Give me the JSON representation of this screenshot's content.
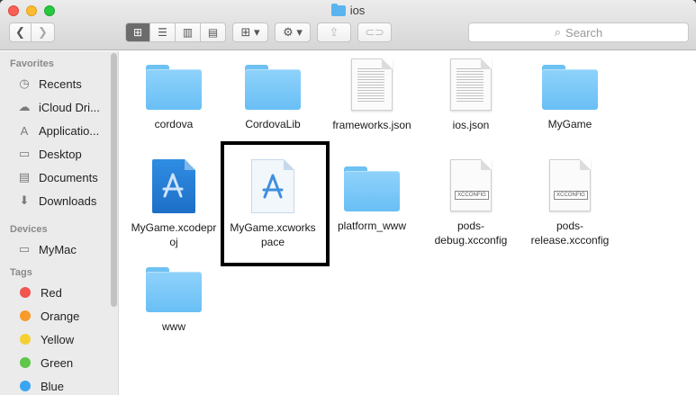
{
  "window": {
    "title": "ios"
  },
  "toolbar": {
    "back_glyph": "❮",
    "forward_glyph": "❯",
    "view_icons": [
      "⊞",
      "☰",
      "▥",
      "▤"
    ],
    "arrange_glyph": "⊞ ▾",
    "action_glyph": "⚙ ▾",
    "share_glyph": "⇪",
    "tags_glyph": "⊂⊃",
    "search_placeholder": "Search",
    "search_glyph": "⌕"
  },
  "sidebar": {
    "favorites_heading": "Favorites",
    "favorites": [
      {
        "label": "Recents",
        "icon": "clock-icon",
        "glyph": "◷"
      },
      {
        "label": "iCloud Dri...",
        "icon": "cloud-icon",
        "glyph": "☁"
      },
      {
        "label": "Applicatio...",
        "icon": "applications-icon",
        "glyph": "A"
      },
      {
        "label": "Desktop",
        "icon": "desktop-icon",
        "glyph": "▭"
      },
      {
        "label": "Documents",
        "icon": "documents-icon",
        "glyph": "▤"
      },
      {
        "label": "Downloads",
        "icon": "downloads-icon",
        "glyph": "⬇"
      }
    ],
    "devices_heading": "Devices",
    "devices": [
      {
        "label": "MyMac",
        "icon": "computer-icon",
        "glyph": "▭"
      }
    ],
    "tags_heading": "Tags",
    "tags": [
      {
        "label": "Red",
        "color": "#f2544e"
      },
      {
        "label": "Orange",
        "color": "#f79b2b"
      },
      {
        "label": "Yellow",
        "color": "#f6cf34"
      },
      {
        "label": "Green",
        "color": "#5ec64a"
      },
      {
        "label": "Blue",
        "color": "#3aa5f3"
      }
    ]
  },
  "files": [
    {
      "name": "cordova",
      "kind": "folder"
    },
    {
      "name": "CordovaLib",
      "kind": "folder"
    },
    {
      "name": "frameworks.json",
      "kind": "text-document"
    },
    {
      "name": "ios.json",
      "kind": "text-document"
    },
    {
      "name": "MyGame",
      "kind": "folder"
    },
    {
      "name": "MyGame.xcodeproj",
      "kind": "xcodeproj"
    },
    {
      "name": "MyGame.xcworkspace",
      "kind": "xcworkspace",
      "selected": true
    },
    {
      "name": "platform_www",
      "kind": "folder"
    },
    {
      "name": "pods-debug.xcconfig",
      "kind": "xcconfig",
      "badge": "XCCONFIG"
    },
    {
      "name": "pods-release.xcconfig",
      "kind": "xcconfig",
      "badge": "XCCONFIG"
    },
    {
      "name": "www",
      "kind": "folder"
    }
  ],
  "file_labels": {
    "f0": "cordova",
    "f1": "CordovaLib",
    "f2": "frameworks.json",
    "f3": "ios.json",
    "f4": "MyGame",
    "f5a": "MyGame.xcodepr",
    "f5b": "oj",
    "f6a": "MyGame.xcworks",
    "f6b": "pace",
    "f7": "platform_www",
    "f8a": "pods-",
    "f8b": "debug.xcconfig",
    "f9a": "pods-",
    "f9b": "release.xcconfig",
    "f10": "www",
    "badge": "XCCONFIG"
  },
  "colors": {
    "folder": "#6ec1f3",
    "selection_outline": "#000000"
  }
}
